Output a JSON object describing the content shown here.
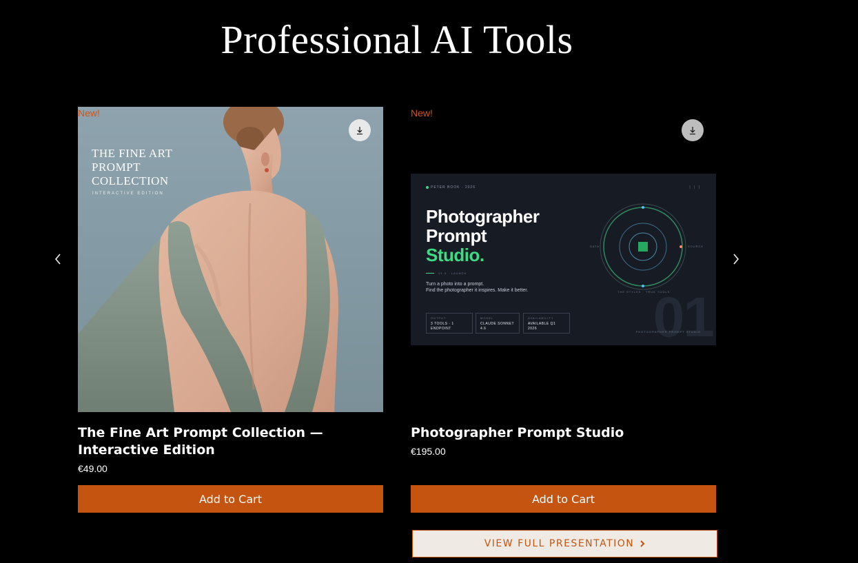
{
  "page": {
    "title": "Professional AI Tools"
  },
  "carousel": {
    "prev_icon": "chevron-left-icon",
    "next_icon": "chevron-right-icon"
  },
  "products": [
    {
      "badge": "New!",
      "name": "The Fine Art Prompt Collection — Interactive Edition",
      "price": "€49.00",
      "add_to_cart": "Add to Cart",
      "download_icon": "download-icon",
      "cover": {
        "title": "THE FINE ART\nPROMPT\nCOLLECTION",
        "subtitle": "INTERACTIVE EDITION"
      }
    },
    {
      "badge": "New!",
      "name": "Photographer Prompt Studio",
      "price": "€195.00",
      "add_to_cart": "Add to Cart",
      "download_icon": "download-icon",
      "banner": {
        "top_left": "PETER BOOK · 2026",
        "top_right": "| | |",
        "headline_1": "Photographer",
        "headline_2": "Prompt",
        "headline_3": "Studio.",
        "rule_label": "V1.0 · LAUNCH",
        "description": "Turn a photo into a prompt.\nFind the photographer it inspires. Make it better.",
        "info": [
          {
            "key": "OUTPUT",
            "value": "3 TOOLS · 1 ENDPOINT"
          },
          {
            "key": "MODEL",
            "value": "CLAUDE SONNET 4.6"
          },
          {
            "key": "AVAILABILITY",
            "value": "AVAILABLE Q1 2026"
          }
        ],
        "orb_left": "DATA",
        "orb_right": "SOURCE",
        "orb_bottom": "THE STYLES · TRUE TOOLS",
        "big_number": "01",
        "footer_label": "PHOTOGRAPHER PROMPT STUDIO"
      }
    }
  ],
  "view_full_presentation": "VIEW FULL PRESENTATION",
  "colors": {
    "accent": "#c4540f",
    "badge": "#d0541a",
    "background": "#000000",
    "studio_green": "#3ddc84"
  }
}
